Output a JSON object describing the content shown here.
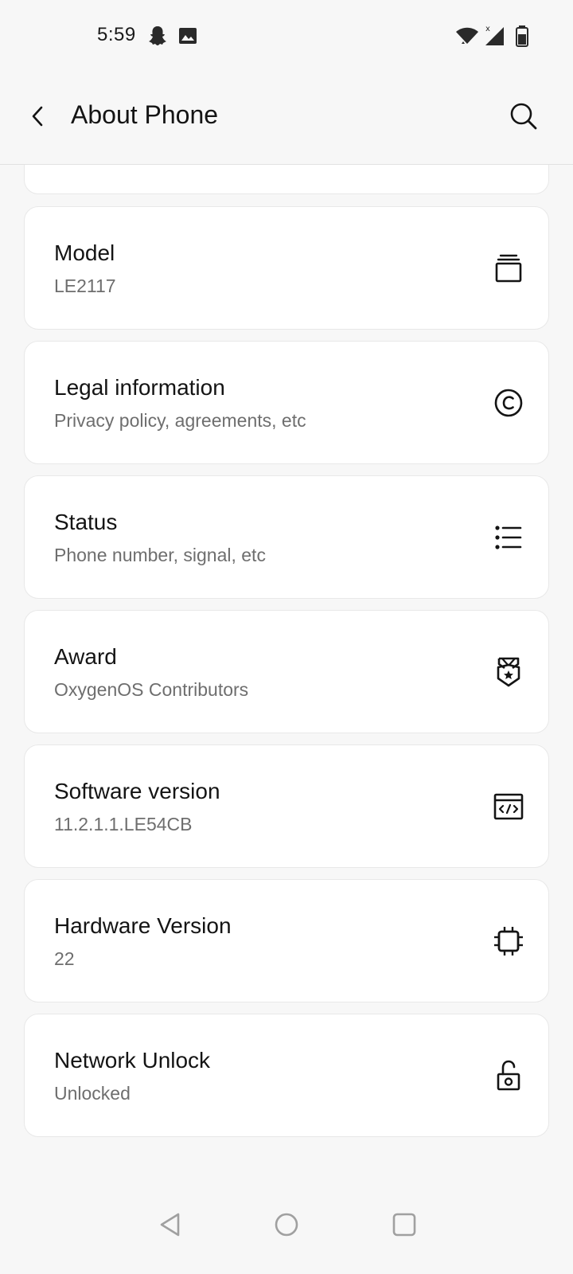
{
  "status_bar": {
    "time": "5:59",
    "icons": [
      "snapchat-icon",
      "image-icon",
      "wifi-icon",
      "signal-icon",
      "battery-icon"
    ]
  },
  "header": {
    "title": "About Phone",
    "back_icon": "chevron-left-icon",
    "search_icon": "search-icon"
  },
  "items": [
    {
      "title": "Model",
      "subtitle": "LE2117",
      "icon": "device-stack-icon"
    },
    {
      "title": "Legal information",
      "subtitle": "Privacy policy, agreements, etc",
      "icon": "copyright-icon"
    },
    {
      "title": "Status",
      "subtitle": "Phone number, signal, etc",
      "icon": "list-icon"
    },
    {
      "title": "Award",
      "subtitle": "OxygenOS Contributors",
      "icon": "award-badge-icon"
    },
    {
      "title": "Software version",
      "subtitle": "11.2.1.1.LE54CB",
      "icon": "code-window-icon"
    },
    {
      "title": "Hardware Version",
      "subtitle": "22",
      "icon": "chip-icon"
    },
    {
      "title": "Network Unlock",
      "subtitle": "Unlocked",
      "icon": "unlock-icon"
    }
  ],
  "nav_bar": {
    "icons": [
      "back-triangle-icon",
      "home-circle-icon",
      "recents-square-icon"
    ]
  },
  "colors": {
    "background": "#f7f7f7",
    "card": "#ffffff",
    "text_primary": "#141414",
    "text_secondary": "#6e6e6e",
    "nav_icon": "#a0a0a0"
  }
}
